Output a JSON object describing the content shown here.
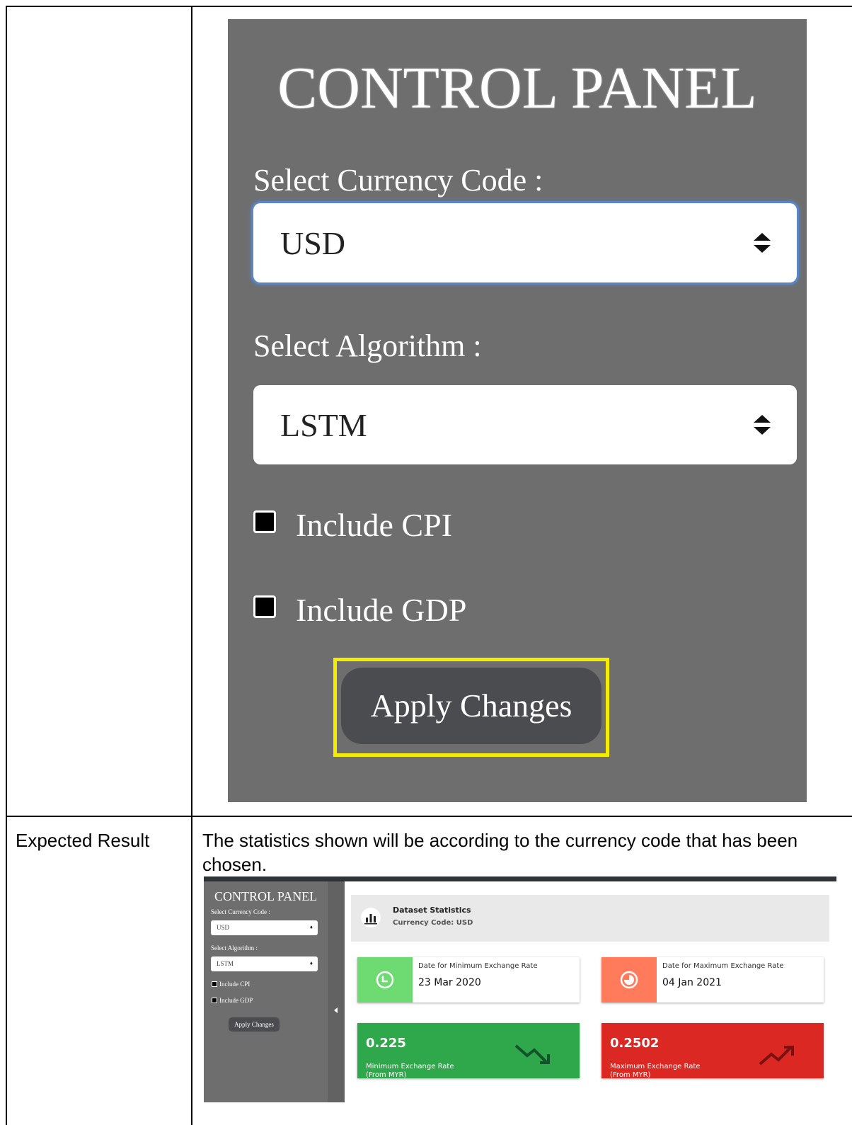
{
  "big_panel": {
    "title": "CONTROL PANEL",
    "currency_label": "Select Currency Code :",
    "currency_value": "USD",
    "algorithm_label": "Select Algorithm :",
    "algorithm_value": "LSTM",
    "cpi_label": "Include CPI",
    "gdp_label": "Include GDP",
    "apply_label": "Apply Changes"
  },
  "row2": {
    "label": "Expected Result",
    "description": "The statistics shown will be according to the currency code that has been chosen."
  },
  "small": {
    "panel_title": "CONTROL PANEL",
    "currency_label": "Select Currency Code :",
    "currency_value": "USD",
    "algorithm_label": "Select Algorithm :",
    "algorithm_value": "LSTM",
    "cpi_label": "Include CPI",
    "gdp_label": "Include GDP",
    "apply_label": "Apply Changes",
    "stats_title": "Dataset Statistics",
    "stats_subtitle": "Currency Code: USD",
    "min_date_label": "Date for Minimum Exchange Rate",
    "min_date_value": "23 Mar 2020",
    "max_date_label": "Date for Maximum Exchange Rate",
    "max_date_value": "04 Jan 2021",
    "min_rate_value": "0.225",
    "min_rate_caption_1": "Minimum Exchange Rate",
    "min_rate_caption_2": "(From MYR)",
    "max_rate_value": "0.2502",
    "max_rate_caption_1": "Maximum Exchange Rate",
    "max_rate_caption_2": "(From MYR)"
  },
  "colors": {
    "panel_bg": "#6e6e6e",
    "highlight": "#f5ec00",
    "button_bg": "#4a4c4f",
    "min_icon_bg": "#6ddb72",
    "max_icon_bg": "#ff7b5c",
    "min_card_bg": "#2ea84a",
    "max_card_bg": "#dc2822"
  }
}
